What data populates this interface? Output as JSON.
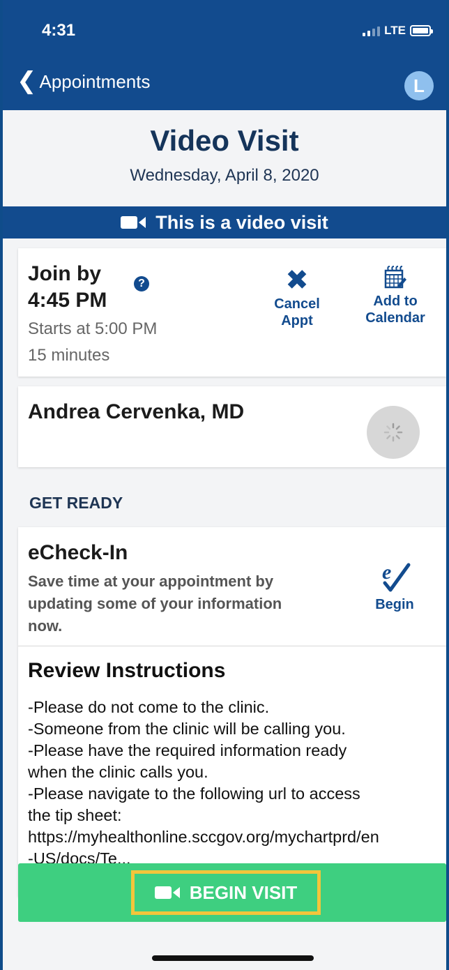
{
  "status_bar": {
    "time": "4:31",
    "network": "LTE"
  },
  "nav": {
    "back_label": "Appointments",
    "avatar_initial": "L"
  },
  "page": {
    "title": "Video Visit",
    "date": "Wednesday, April 8, 2020"
  },
  "banner": {
    "text": "This is a video visit"
  },
  "appointment": {
    "join_line1": "Join by",
    "join_line2": "4:45 PM",
    "help": "?",
    "starts": "Starts at 5:00 PM",
    "duration": "15 minutes",
    "cancel_line1": "Cancel",
    "cancel_line2": "Appt",
    "calendar_line1": "Add to",
    "calendar_line2": "Calendar"
  },
  "provider": {
    "name": "Andrea Cervenka, MD"
  },
  "section": {
    "get_ready": "GET READY"
  },
  "echeckin": {
    "title": "eCheck-In",
    "desc_line1": "Save time at your appointment by",
    "desc_line2": "updating some of your information",
    "desc_line3": "now.",
    "begin": "Begin"
  },
  "instructions": {
    "title": "Review Instructions",
    "lines": [
      "-Please do not come to the clinic.",
      "-Someone from the clinic will be calling you.",
      "-Please have the required information ready",
      "when the clinic calls you.",
      "-Please navigate to the following url to access",
      "the tip sheet:",
      "https://myhealthonline.sccgov.org/mychartprd/en",
      "-US/docs/Te..."
    ]
  },
  "action": {
    "begin_visit": "BEGIN VISIT"
  },
  "colors": {
    "brand": "#124b8e",
    "begin_button": "#3ecf80",
    "highlight": "#f3c53b"
  }
}
